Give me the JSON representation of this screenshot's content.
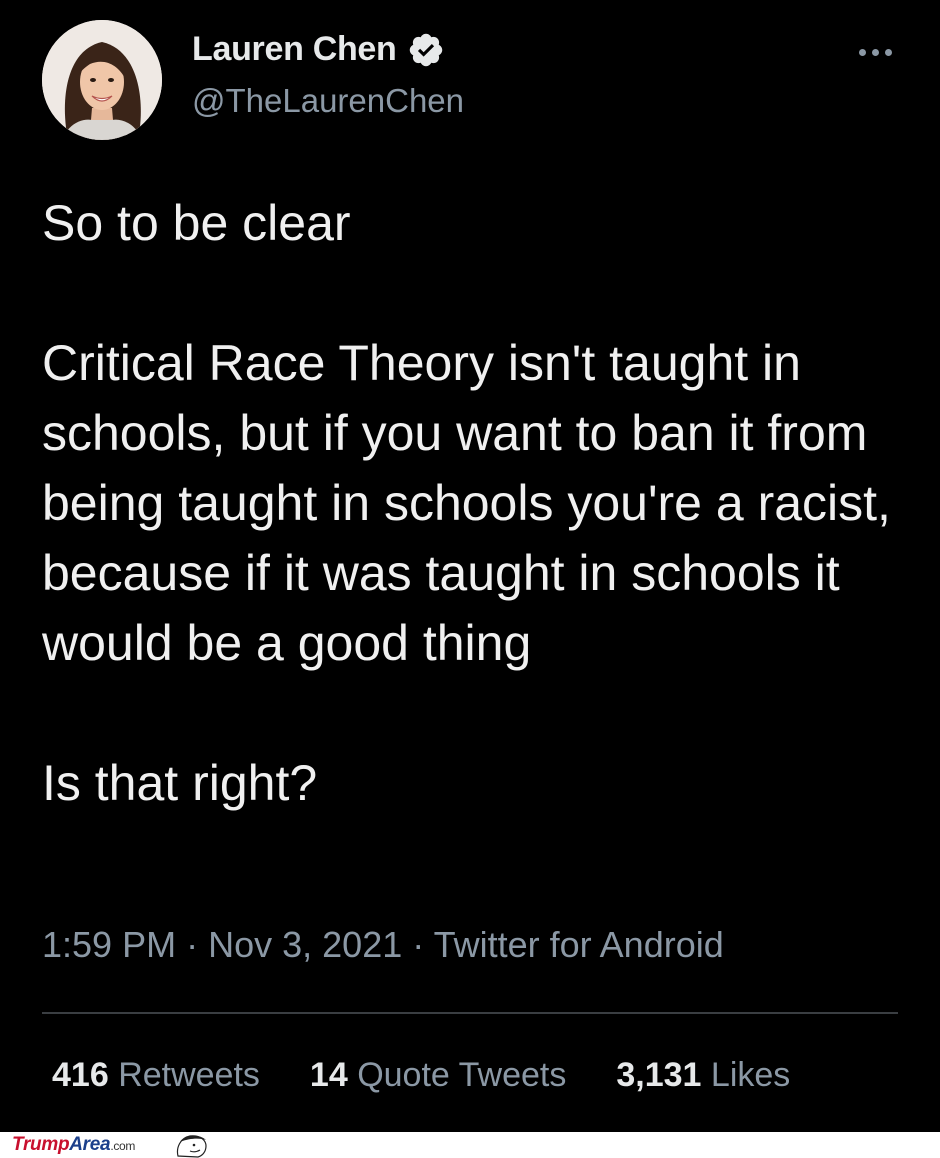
{
  "author": {
    "display_name": "Lauren Chen",
    "handle": "@TheLaurenChen",
    "verified": true,
    "avatar_icon": "profile-photo"
  },
  "menu_icon": "more-horizontal-icon",
  "tweet": {
    "paragraphs": [
      "So to be clear",
      "Critical Race Theory isn't taught in schools, but if you want to ban it from being taught in schools you're a racist, because if it was taught in schools it would be a good thing",
      "Is that right?"
    ]
  },
  "meta": {
    "time": "1:59 PM",
    "separator": "·",
    "date": "Nov 3, 2021",
    "source": "Twitter for Android"
  },
  "stats": {
    "retweets_count": "416",
    "retweets_label": "Retweets",
    "quotes_count": "14",
    "quotes_label": "Quote Tweets",
    "likes_count": "3,131",
    "likes_label": "Likes"
  },
  "watermark": {
    "part1": "Trump",
    "part2": "Area",
    "part3": ".com"
  },
  "colors": {
    "background": "#000000",
    "text_primary": "#e7e9ea",
    "text_secondary": "#8b98a5",
    "divider": "#3a3e42"
  }
}
